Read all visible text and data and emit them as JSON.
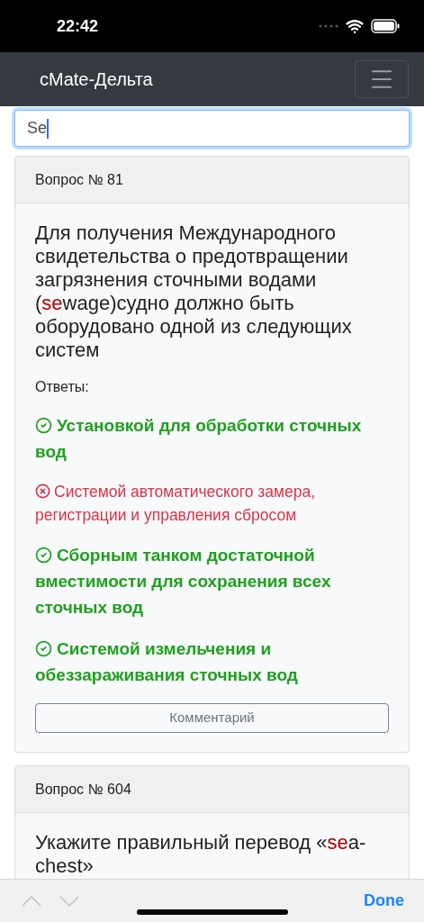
{
  "status_bar": {
    "time": "22:42"
  },
  "navbar": {
    "title": "cMate-Дельта"
  },
  "search": {
    "value": "Se",
    "focused": true
  },
  "questions": [
    {
      "header": "Вопрос № 81",
      "text": [
        {
          "t": "Для получения Международного свидетельства о предотвращении загрязнения сточными водами (",
          "highlight": false
        },
        {
          "t": "se",
          "highlight": true
        },
        {
          "t": "wage)судно должно быть оборудовано одной из следующих систем",
          "highlight": false
        }
      ],
      "answers_label": "Ответы:",
      "answers": [
        {
          "text": "Установкой для обработки сточных вод",
          "correct": true
        },
        {
          "text": "Системой автоматического замера, регистрации и управления сбросом",
          "correct": false
        },
        {
          "text": "Сборным танком достаточной вместимости для сохранения всех сточных вод",
          "correct": true
        },
        {
          "text": "Системой измельчения и обеззараживания сточных вод",
          "correct": true
        }
      ],
      "comment_button": "Комментарий"
    },
    {
      "header": "Вопрос № 604",
      "text": [
        {
          "t": "Укажите правильный перевод «",
          "highlight": false
        },
        {
          "t": "se",
          "highlight": true
        },
        {
          "t": "a-chest»",
          "highlight": false
        }
      ]
    }
  ],
  "accessory_bar": {
    "done": "Done"
  }
}
